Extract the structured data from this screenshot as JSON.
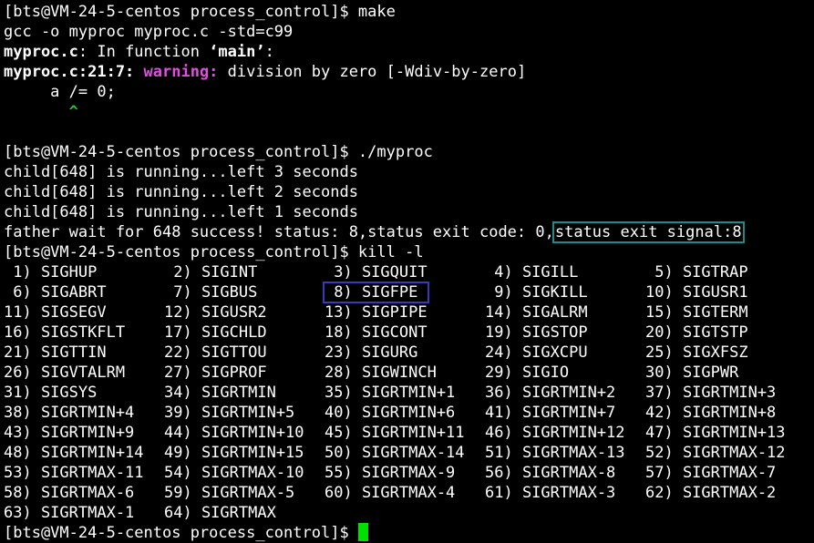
{
  "terminal": {
    "prompt1": "[bts@VM-24-5-centos process_control]$ make",
    "compile_cmd": "gcc -o myproc myproc.c -std=c99",
    "warn_file": "myproc.c",
    "warn_infunc": ": In function ",
    "warn_func": "‘main’",
    "warn_colon": ":",
    "warn_loc": "myproc.c:21:7: ",
    "warn_label": "warning:",
    "warn_msg": " division by zero [-Wdiv-by-zero]",
    "code_line": "     a /= 0;",
    "caret_line": "       ^",
    "blank": "",
    "prompt2": "[bts@VM-24-5-centos process_control]$ ./myproc",
    "child1": "child[648] is running...left 3 seconds",
    "child2": "child[648] is running...left 2 seconds",
    "child3": "child[648] is running...left 1 seconds",
    "father_prefix": "father wait for 648 success! status: 8,status exit code: 0,",
    "father_signal": "status exit signal:8",
    "prompt3": "[bts@VM-24-5-centos process_control]$ kill -l",
    "prompt4": "[bts@VM-24-5-centos process_control]$ "
  },
  "signals": [
    [
      " 1) SIGHUP",
      " 2) SIGINT",
      " 3) SIGQUIT",
      " 4) SIGILL",
      " 5) SIGTRAP"
    ],
    [
      " 6) SIGABRT",
      " 7) SIGBUS",
      " 8) SIGFPE",
      " 9) SIGKILL",
      "10) SIGUSR1"
    ],
    [
      "11) SIGSEGV",
      "12) SIGUSR2",
      "13) SIGPIPE",
      "14) SIGALRM",
      "15) SIGTERM"
    ],
    [
      "16) SIGSTKFLT",
      "17) SIGCHLD",
      "18) SIGCONT",
      "19) SIGSTOP",
      "20) SIGTSTP"
    ],
    [
      "21) SIGTTIN",
      "22) SIGTTOU",
      "23) SIGURG",
      "24) SIGXCPU",
      "25) SIGXFSZ"
    ],
    [
      "26) SIGVTALRM",
      "27) SIGPROF",
      "28) SIGWINCH",
      "29) SIGIO",
      "30) SIGPWR"
    ],
    [
      "31) SIGSYS",
      "34) SIGRTMIN",
      "35) SIGRTMIN+1",
      "36) SIGRTMIN+2",
      "37) SIGRTMIN+3"
    ],
    [
      "38) SIGRTMIN+4",
      "39) SIGRTMIN+5",
      "40) SIGRTMIN+6",
      "41) SIGRTMIN+7",
      "42) SIGRTMIN+8"
    ],
    [
      "43) SIGRTMIN+9",
      "44) SIGRTMIN+10",
      "45) SIGRTMIN+11",
      "46) SIGRTMIN+12",
      "47) SIGRTMIN+13"
    ],
    [
      "48) SIGRTMIN+14",
      "49) SIGRTMIN+15",
      "50) SIGRTMAX-14",
      "51) SIGRTMAX-13",
      "52) SIGRTMAX-12"
    ],
    [
      "53) SIGRTMAX-11",
      "54) SIGRTMAX-10",
      "55) SIGRTMAX-9",
      "56) SIGRTMAX-8",
      "57) SIGRTMAX-7"
    ],
    [
      "58) SIGRTMAX-6",
      "59) SIGRTMAX-5",
      "60) SIGRTMAX-4",
      "61) SIGRTMAX-3",
      "62) SIGRTMAX-2"
    ],
    [
      "63) SIGRTMAX-1",
      "64) SIGRTMAX"
    ]
  ],
  "highlight_signal": " 8) SIGFPE",
  "colors": {
    "background": "#000000",
    "text": "#ffffff",
    "warning": "#e04fe0",
    "caret": "#22c72a",
    "cursor": "#00e000",
    "box_teal": "#1e8a8a",
    "box_blue": "#3a3ab8"
  }
}
